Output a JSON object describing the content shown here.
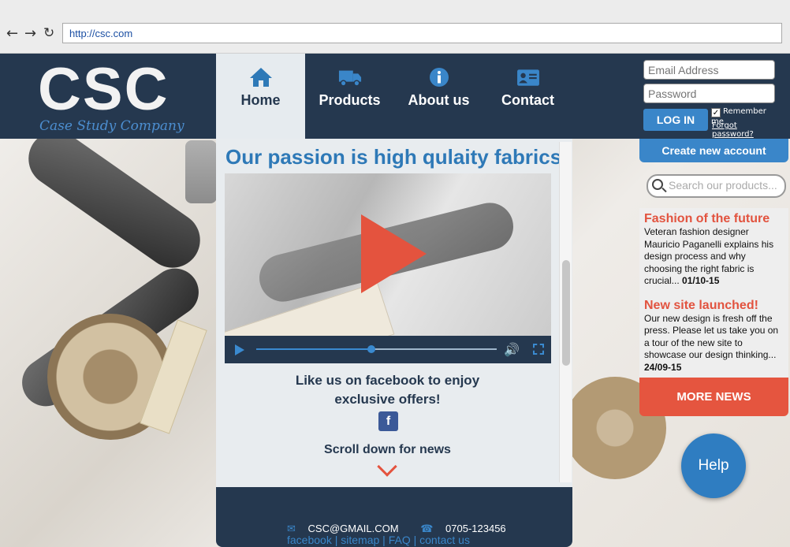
{
  "browser": {
    "url": "http://csc.com"
  },
  "logo": {
    "mark": "CSC",
    "tagline": "Case Study Company"
  },
  "nav": {
    "tabs": [
      {
        "label": "Home",
        "icon": "home-icon",
        "active": true
      },
      {
        "label": "Products",
        "icon": "truck-icon"
      },
      {
        "label": "About us",
        "icon": "info-icon"
      },
      {
        "label": "Contact",
        "icon": "contact-card-icon"
      }
    ]
  },
  "login": {
    "email_placeholder": "Email Address",
    "password_placeholder": "Password",
    "button": "LOG IN",
    "remember": "Remember me",
    "remember_checked": true,
    "forgot": "Forgot password?",
    "create_account": "Create new account"
  },
  "search": {
    "placeholder": "Search our products..."
  },
  "news": {
    "items": [
      {
        "title": "Fashion of the future",
        "body": "Veteran fashion designer Mauricio Paganelli explains his design process and why choosing the right fabric is crucial...",
        "date": "01/10-15"
      },
      {
        "title": "New site launched!",
        "body": "Our new design is fresh off the press. Please let us take you on a tour of the new site to showcase our design thinking...",
        "date": "24/09-15"
      }
    ],
    "more": "MORE NEWS"
  },
  "help": {
    "label": "Help"
  },
  "main": {
    "headline": "Our passion is high qulaity fabrics",
    "video": {
      "progress": 0.48
    },
    "promo_line1": "Like us on facebook to enjoy",
    "promo_line2": "exclusive offers!",
    "facebook_letter": "f",
    "scroll_hint": "Scroll down for news"
  },
  "footer": {
    "email": "CSC@GMAIL.COM",
    "phone": "0705-123456",
    "links": [
      "facebook",
      "sitemap",
      "FAQ",
      "contact us"
    ]
  },
  "colors": {
    "navy": "#25384f",
    "blue": "#3a86c9",
    "red": "#e4533e"
  }
}
